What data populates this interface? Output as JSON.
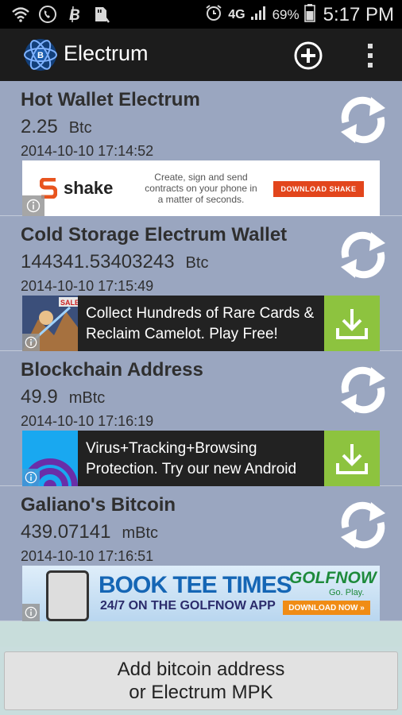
{
  "status_bar": {
    "battery": "69%",
    "time": "5:17 PM",
    "network": "4G"
  },
  "app": {
    "title": "Electrum",
    "add_icon": "plus-circle-icon",
    "menu_icon": "overflow-menu-icon"
  },
  "wallets": [
    {
      "name": "Hot Wallet Electrum",
      "amount": "2.25",
      "unit": "Btc",
      "date": "2014-10-10 17:14:52",
      "ad": {
        "kind": "shake",
        "brand": "shake",
        "text": "Create, sign and send contracts on your phone in a matter of seconds.",
        "cta": "DOWNLOAD SHAKE"
      }
    },
    {
      "name": "Cold Storage Electrum Wallet",
      "amount": "144341.53403243",
      "unit": "Btc",
      "date": "2014-10-10 17:15:49",
      "ad": {
        "kind": "app",
        "thumb_label": "SALE!",
        "text": "Collect Hundreds of Rare Cards & Reclaim Camelot. Play Free!"
      }
    },
    {
      "name": "Blockchain Address",
      "amount": "49.9",
      "unit": "mBtc",
      "date": "2014-10-10 17:16:19",
      "ad": {
        "kind": "app",
        "text": "Virus+Tracking+Browsing Protection. Try our new Android"
      }
    },
    {
      "name": "Galiano's Bitcoin",
      "amount": "439.07141",
      "unit": "mBtc",
      "date": "2014-10-10 17:16:51",
      "ad": {
        "kind": "golf",
        "headline": "BOOK TEE TIMES",
        "subline": "24/7 ON THE GOLFNOW APP",
        "brand": "GOLFNOW",
        "tagline": "Go. Play.",
        "cta": "DOWNLOAD NOW »"
      }
    }
  ],
  "footer": {
    "add_button_line1": "Add bitcoin address",
    "add_button_line2": "or Electrum MPK"
  },
  "colors": {
    "list_bg": "#9aa6c0",
    "appbar_bg": "#1c1c1c",
    "download_green": "#8dc33f"
  }
}
